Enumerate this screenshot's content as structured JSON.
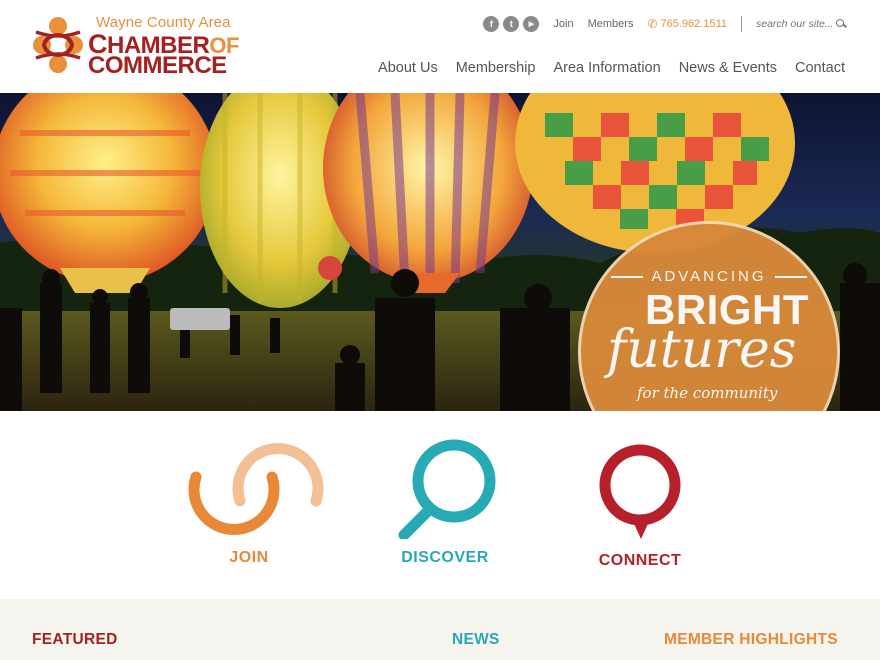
{
  "logo": {
    "top_line": "Wayne County Area",
    "line1_a": "HAMBER",
    "line1_b": "OF",
    "line2": "COMMERCE"
  },
  "utility": {
    "social": [
      {
        "name": "facebook-icon",
        "glyph": "f"
      },
      {
        "name": "twitter-icon",
        "glyph": "t"
      },
      {
        "name": "youtube-icon",
        "glyph": "▶"
      }
    ],
    "join": "Join",
    "members": "Members",
    "phone": "765.962.1511",
    "search_placeholder": "search our site..."
  },
  "nav": {
    "items": [
      "About Us",
      "Membership",
      "Area Information",
      "News & Events",
      "Contact"
    ]
  },
  "hero": {
    "advancing": "ADVANCING",
    "bright": "BRIGHT",
    "futures": "futures",
    "community": "for the community"
  },
  "actions": [
    {
      "label": "JOIN",
      "color": "#e8893a"
    },
    {
      "label": "DISCOVER",
      "color": "#27aab3"
    },
    {
      "label": "CONNECT",
      "color": "#b5202a"
    }
  ],
  "bottom": {
    "featured": "FEATURED",
    "news": "NEWS",
    "highlights": "MEMBER HIGHLIGHTS"
  },
  "colors": {
    "brand_red": "#a3221f",
    "brand_orange": "#e8903a",
    "teal": "#27aab3"
  }
}
